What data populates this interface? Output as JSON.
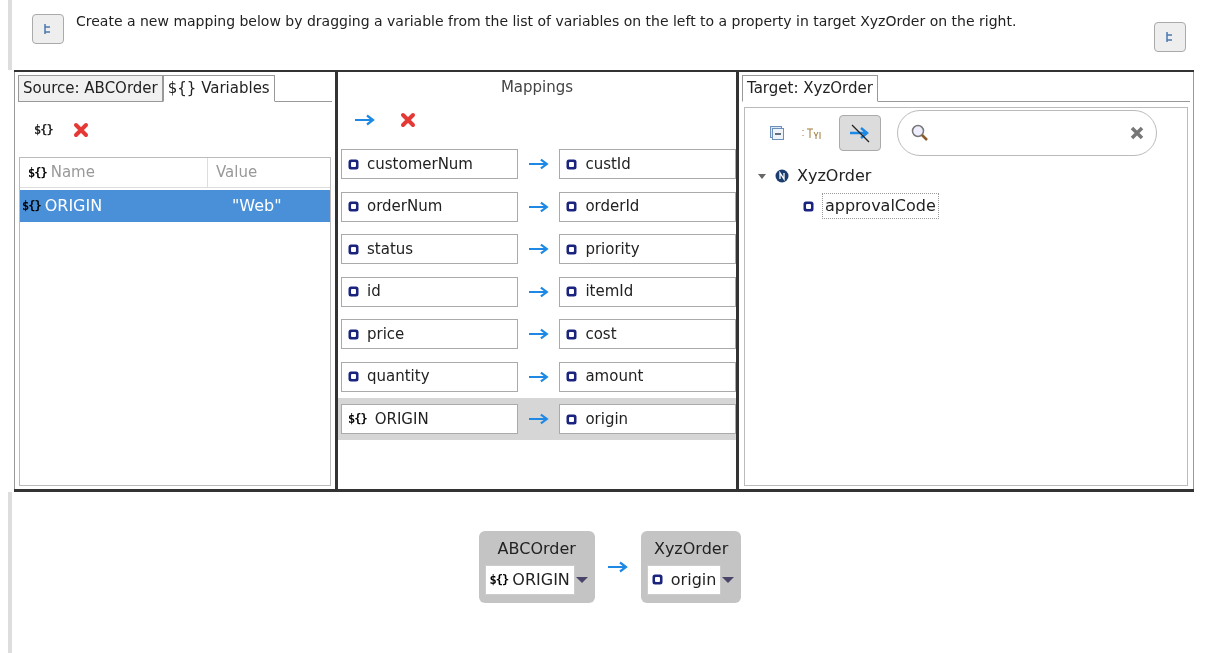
{
  "header": {
    "text": "Create a new mapping below by dragging a variable from the list of variables on the left to a property in target XyzOrder on the right."
  },
  "source": {
    "tabs": [
      {
        "label": "Source: ABCOrder",
        "selected": false
      },
      {
        "label": "${} Variables",
        "selected": true
      }
    ],
    "table": {
      "columns": [
        {
          "prefix": "${}",
          "label": "Name"
        },
        {
          "label": "Value"
        }
      ],
      "rows": [
        {
          "prefix": "${}",
          "name": "ORIGIN",
          "value": "\"Web\"",
          "selected": true
        }
      ]
    }
  },
  "mappings": {
    "title": "Mappings",
    "rows": [
      {
        "source": {
          "kind": "field",
          "label": "customerNum"
        },
        "target": {
          "kind": "field",
          "label": "custId"
        },
        "selected": false
      },
      {
        "source": {
          "kind": "field",
          "label": "orderNum"
        },
        "target": {
          "kind": "field",
          "label": "orderId"
        },
        "selected": false
      },
      {
        "source": {
          "kind": "field",
          "label": "status"
        },
        "target": {
          "kind": "field",
          "label": "priority"
        },
        "selected": false
      },
      {
        "source": {
          "kind": "field",
          "label": "id"
        },
        "target": {
          "kind": "field",
          "label": "itemId"
        },
        "selected": false
      },
      {
        "source": {
          "kind": "field",
          "label": "price"
        },
        "target": {
          "kind": "field",
          "label": "cost"
        },
        "selected": false
      },
      {
        "source": {
          "kind": "field",
          "label": "quantity"
        },
        "target": {
          "kind": "field",
          "label": "amount"
        },
        "selected": false
      },
      {
        "source": {
          "kind": "variable",
          "prefix": "${}",
          "label": "ORIGIN"
        },
        "target": {
          "kind": "field",
          "label": "origin"
        },
        "selected": true
      }
    ]
  },
  "target": {
    "tab": {
      "label": "Target: XyzOrder",
      "selected": true
    },
    "filter_pressed": true,
    "tree": [
      {
        "label": "XyzOrder",
        "expanded": true,
        "children": [
          {
            "label": "approvalCode",
            "selected": true
          }
        ]
      }
    ]
  },
  "detail": {
    "source": {
      "title": "ABCOrder",
      "kind": "variable",
      "prefix": "${}",
      "value": "ORIGIN"
    },
    "target": {
      "title": "XyzOrder",
      "kind": "field",
      "value": "origin"
    }
  }
}
